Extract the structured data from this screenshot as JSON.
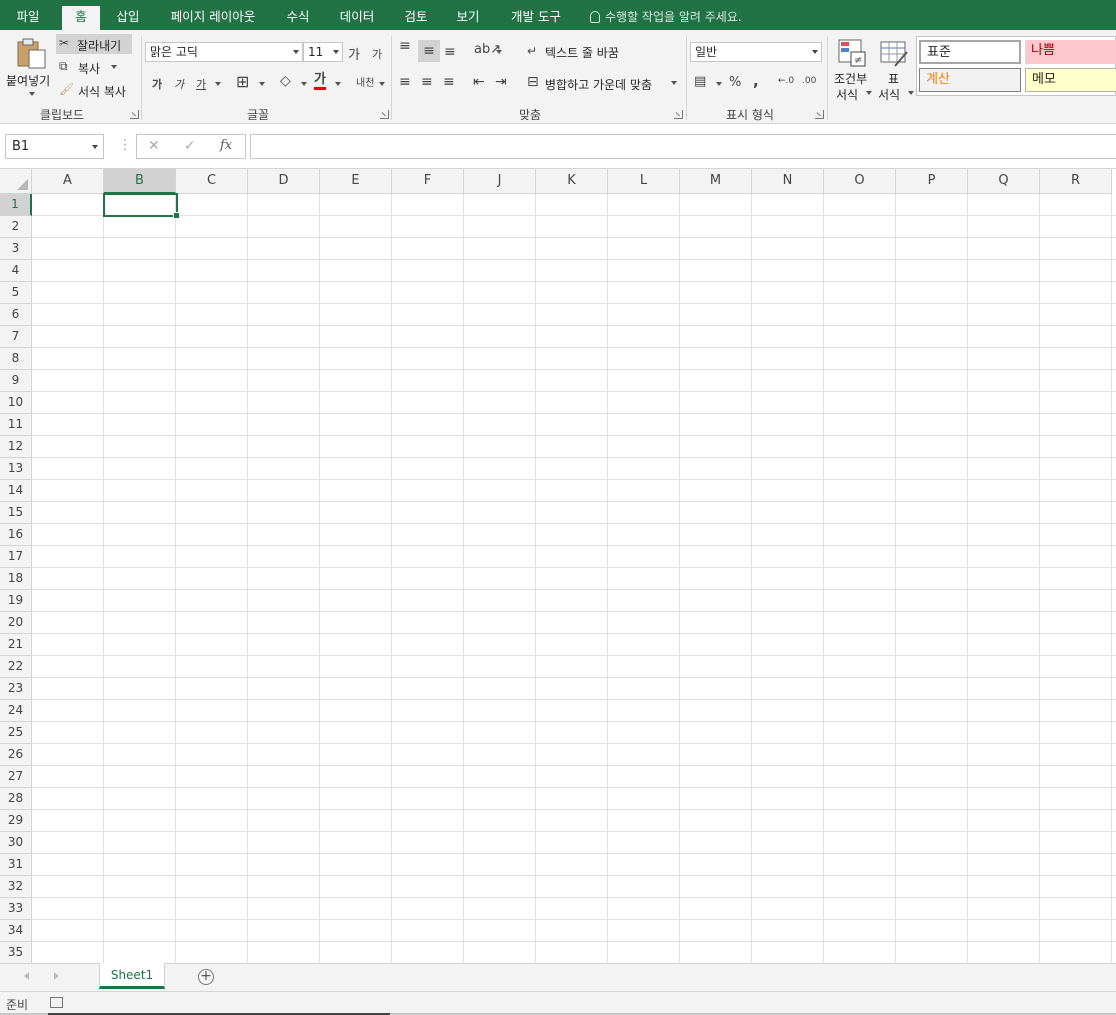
{
  "tabs": [
    "파일",
    "홈",
    "삽입",
    "페이지 레이아웃",
    "수식",
    "데이터",
    "검토",
    "보기",
    "개발 도구"
  ],
  "active_tab": "홈",
  "tell_me": "수행할 작업을 알려 주세요.",
  "clipboard": {
    "paste": "붙여넣기",
    "cut": "잘라내기",
    "copy": "복사",
    "format_painter": "서식 복사",
    "group": "클립보드"
  },
  "font": {
    "name": "맑은 고딕",
    "size": "11",
    "grow": "가",
    "shrink": "가",
    "bold": "가",
    "italic": "가",
    "underline": "가",
    "font_color": "가",
    "phonetic": "내천",
    "group": "글꼴"
  },
  "alignment": {
    "wrap_text": "텍스트 줄 바꿈",
    "merge_center": "병합하고 가운데 맞춤",
    "group": "맞춤"
  },
  "number": {
    "format": "일반",
    "percent": "%",
    "comma": ",",
    "group": "표시 형식"
  },
  "styles": {
    "conditional": [
      "조건부",
      "서식"
    ],
    "table": [
      "표",
      "서식"
    ],
    "normal": "표준",
    "bad": "나쁨",
    "calc": "계산",
    "memo": "메모",
    "colors": {
      "normal_bg": "#ffffff",
      "bad_bg": "#ffc7ce",
      "bad_fg": "#9c0006",
      "calc_bg": "#f2f2f2",
      "calc_fg": "#fa7d00",
      "memo_bg": "#ffffcc"
    }
  },
  "formula_bar": {
    "name_box": "B1",
    "cancel": "✕",
    "enter": "✓",
    "fx": "fx",
    "value": ""
  },
  "columns": [
    "A",
    "B",
    "C",
    "D",
    "E",
    "F",
    "J",
    "K",
    "L",
    "M",
    "N",
    "O",
    "P",
    "Q",
    "R"
  ],
  "selected_column": "B",
  "rows": [
    "1",
    "2",
    "3",
    "4",
    "5",
    "6",
    "7",
    "8",
    "9",
    "10",
    "11",
    "12",
    "13",
    "14",
    "15",
    "16",
    "17",
    "18",
    "19",
    "20",
    "21",
    "22",
    "23",
    "24",
    "25",
    "26",
    "27",
    "28",
    "29",
    "30",
    "31",
    "32",
    "33",
    "34",
    "35"
  ],
  "selected_row": "1",
  "sheets": [
    "Sheet1"
  ],
  "status": "준비",
  "accent": "#217346"
}
